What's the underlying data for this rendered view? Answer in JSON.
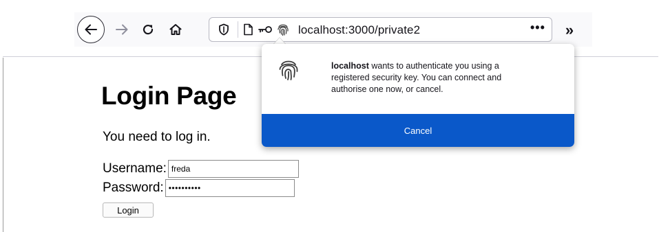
{
  "toolbar": {
    "url_host": "localhost",
    "url_rest": ":3000/private2",
    "page_actions_label": "•••",
    "overflow_label": "»"
  },
  "page": {
    "title": "Login Page",
    "message": "You need to log in.",
    "username_label": "Username:",
    "username_value": "freda",
    "password_label": "Password:",
    "password_value": "••••••••••",
    "login_label": "Login"
  },
  "popup": {
    "host": "localhost",
    "message": " wants to authenticate you using a registered security key. You can connect and authorise one now, or cancel.",
    "cancel_label": "Cancel",
    "accent_color": "#0a58c9"
  },
  "icons": [
    "back-arrow-icon",
    "forward-arrow-icon",
    "reload-icon",
    "home-icon",
    "shield-icon",
    "page-icon",
    "key-icon",
    "fingerprint-icon"
  ]
}
